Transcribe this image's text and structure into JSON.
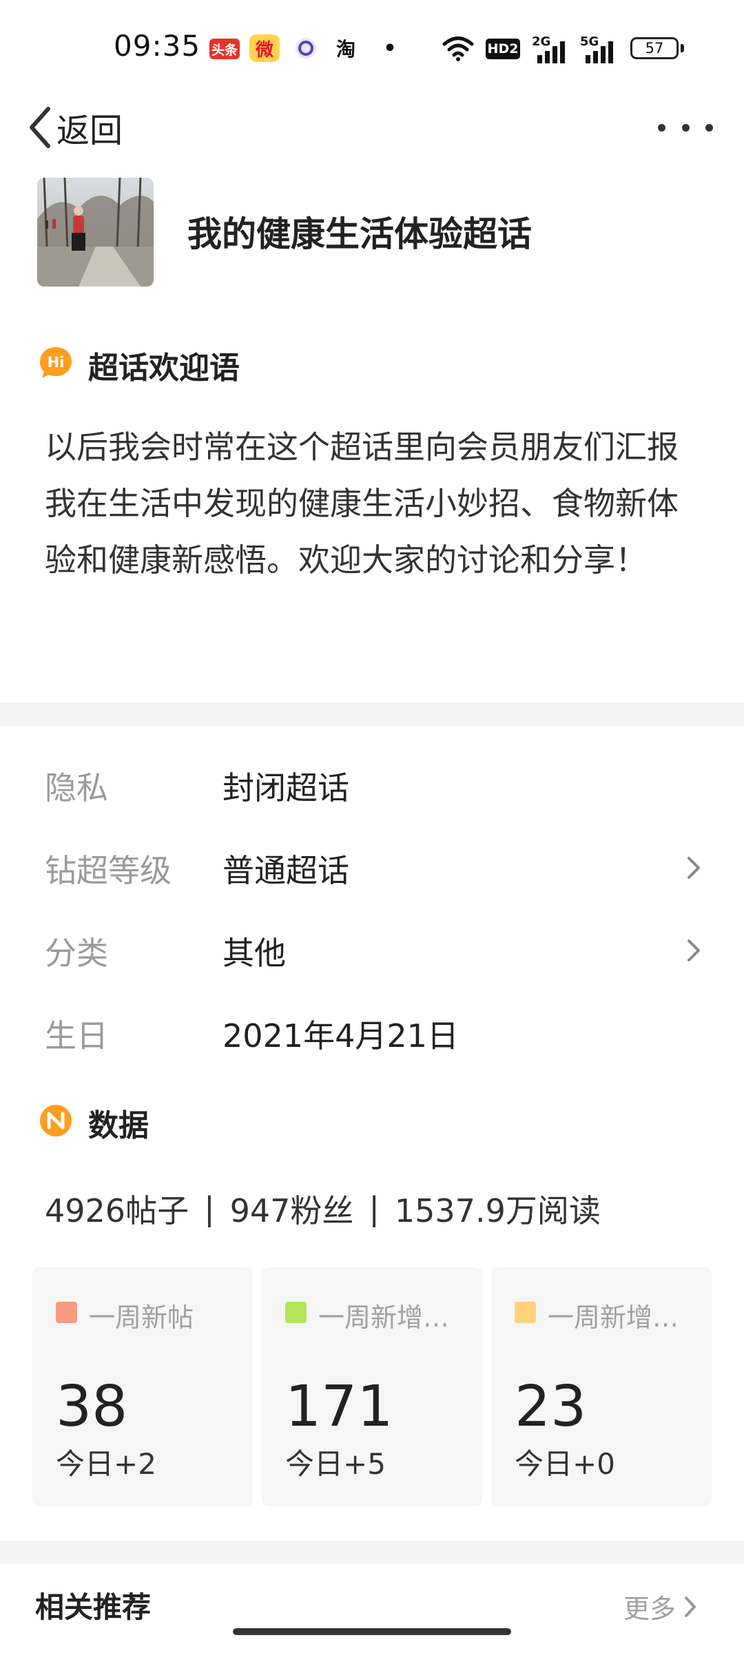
{
  "status_bar": {
    "time": "09:35",
    "toutiao": "头条",
    "weibo": "微",
    "taobao": "淘",
    "dot": "•",
    "hd": "HD2",
    "net_2g": "2G",
    "net_5g": "5G",
    "battery": "57"
  },
  "nav": {
    "back_label": "返回"
  },
  "header": {
    "title": "我的健康生活体验超话"
  },
  "welcome": {
    "heading": "超话欢迎语",
    "icon_text": "Hi",
    "text": "以后我会时常在这个超话里向会员朋友们汇报我在生活中发现的健康生活小妙招、食物新体验和健康新感悟。欢迎大家的讨论和分享！"
  },
  "info": {
    "privacy": {
      "label": "隐私",
      "value": "封闭超话"
    },
    "level": {
      "label": "钻超等级",
      "value": "普通超话"
    },
    "category": {
      "label": "分类",
      "value": "其他"
    },
    "birthday": {
      "label": "生日",
      "value": "2021年4月21日"
    }
  },
  "data": {
    "heading": "数据",
    "posts": "4926帖子",
    "fans": "947粉丝",
    "reads": "1537.9万阅读",
    "separator": "|",
    "cards": [
      {
        "label": "一周新帖",
        "value": "38",
        "today": "今日+2",
        "color": "#f79a83"
      },
      {
        "label": "一周新增…",
        "value": "171",
        "today": "今日+5",
        "color": "#b5e35a"
      },
      {
        "label": "一周新增…",
        "value": "23",
        "today": "今日+0",
        "color": "#fdd27a"
      }
    ]
  },
  "related": {
    "title": "相关推荐",
    "more": "更多"
  },
  "colors": {
    "accent_orange": "#ff9d1f",
    "page_bg": "#ffffff",
    "divider": "#f4f4f4"
  }
}
